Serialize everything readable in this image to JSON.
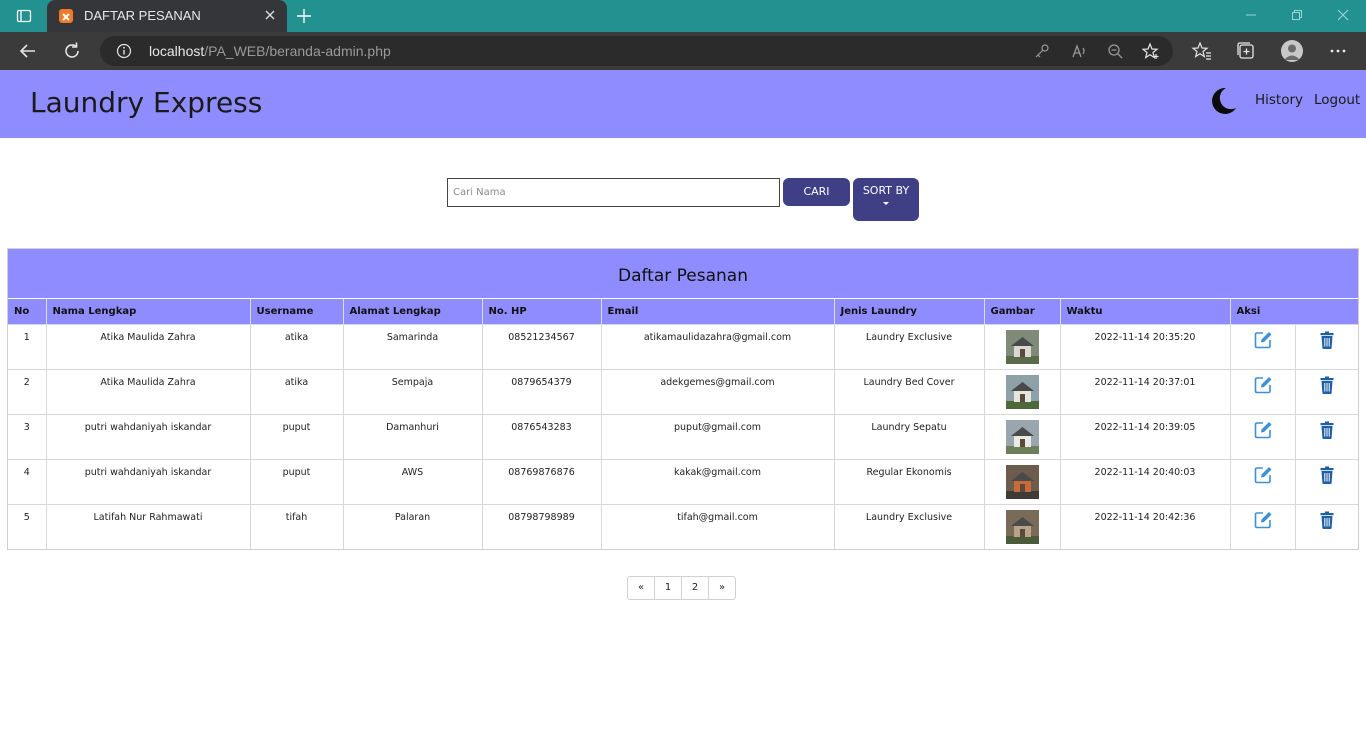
{
  "browser": {
    "tab_title": "DAFTAR PESANAN",
    "url_host": "localhost",
    "url_path": "/PA_WEB/beranda-admin.php"
  },
  "header": {
    "brand": "Laundry Express",
    "nav": [
      "History",
      "Logout"
    ]
  },
  "search": {
    "placeholder": "Cari Nama",
    "value": "",
    "search_button": "CARI",
    "sort_button": "SORT BY"
  },
  "table": {
    "title": "Daftar Pesanan",
    "columns": [
      "No",
      "Nama Lengkap",
      "Username",
      "Alamat Lengkap",
      "No. HP",
      "Email",
      "Jenis Laundry",
      "Gambar",
      "Waktu",
      "Aksi"
    ],
    "rows": [
      {
        "no": "1",
        "nama": "Atika Maulida Zahra",
        "username": "atika",
        "alamat": "Samarinda",
        "hp": "08521234567",
        "email": "atikamaulidazahra@gmail.com",
        "jenis": "Laundry Exclusive",
        "waktu": "2022-11-14 20:35:20"
      },
      {
        "no": "2",
        "nama": "Atika Maulida Zahra",
        "username": "atika",
        "alamat": "Sempaja",
        "hp": "0879654379",
        "email": "adekgemes@gmail.com",
        "jenis": "Laundry Bed Cover",
        "waktu": "2022-11-14 20:37:01"
      },
      {
        "no": "3",
        "nama": "putri wahdaniyah iskandar",
        "username": "puput",
        "alamat": "Damanhuri",
        "hp": "0876543283",
        "email": "puput@gmail.com",
        "jenis": "Laundry Sepatu",
        "waktu": "2022-11-14 20:39:05"
      },
      {
        "no": "4",
        "nama": "putri wahdaniyah iskandar",
        "username": "puput",
        "alamat": "AWS",
        "hp": "08769876876",
        "email": "kakak@gmail.com",
        "jenis": "Regular Ekonomis",
        "waktu": "2022-11-14 20:40:03"
      },
      {
        "no": "5",
        "nama": "Latifah Nur Rahmawati",
        "username": "tifah",
        "alamat": "Palaran",
        "hp": "08798798989",
        "email": "tifah@gmail.com",
        "jenis": "Laundry Exclusive",
        "waktu": "2022-11-14 20:42:36"
      }
    ]
  },
  "pagination": [
    "«",
    "1",
    "2",
    "»"
  ],
  "colors": {
    "header_bg": "#8e8cff",
    "button_bg": "#3f3f86",
    "edit_icon": "#3d8fd6",
    "delete_icon": "#1f5fa5",
    "tabbar_bg": "#23918f"
  },
  "icons": {
    "edit": "edit-icon",
    "delete": "trash-icon",
    "theme": "moon-icon"
  }
}
